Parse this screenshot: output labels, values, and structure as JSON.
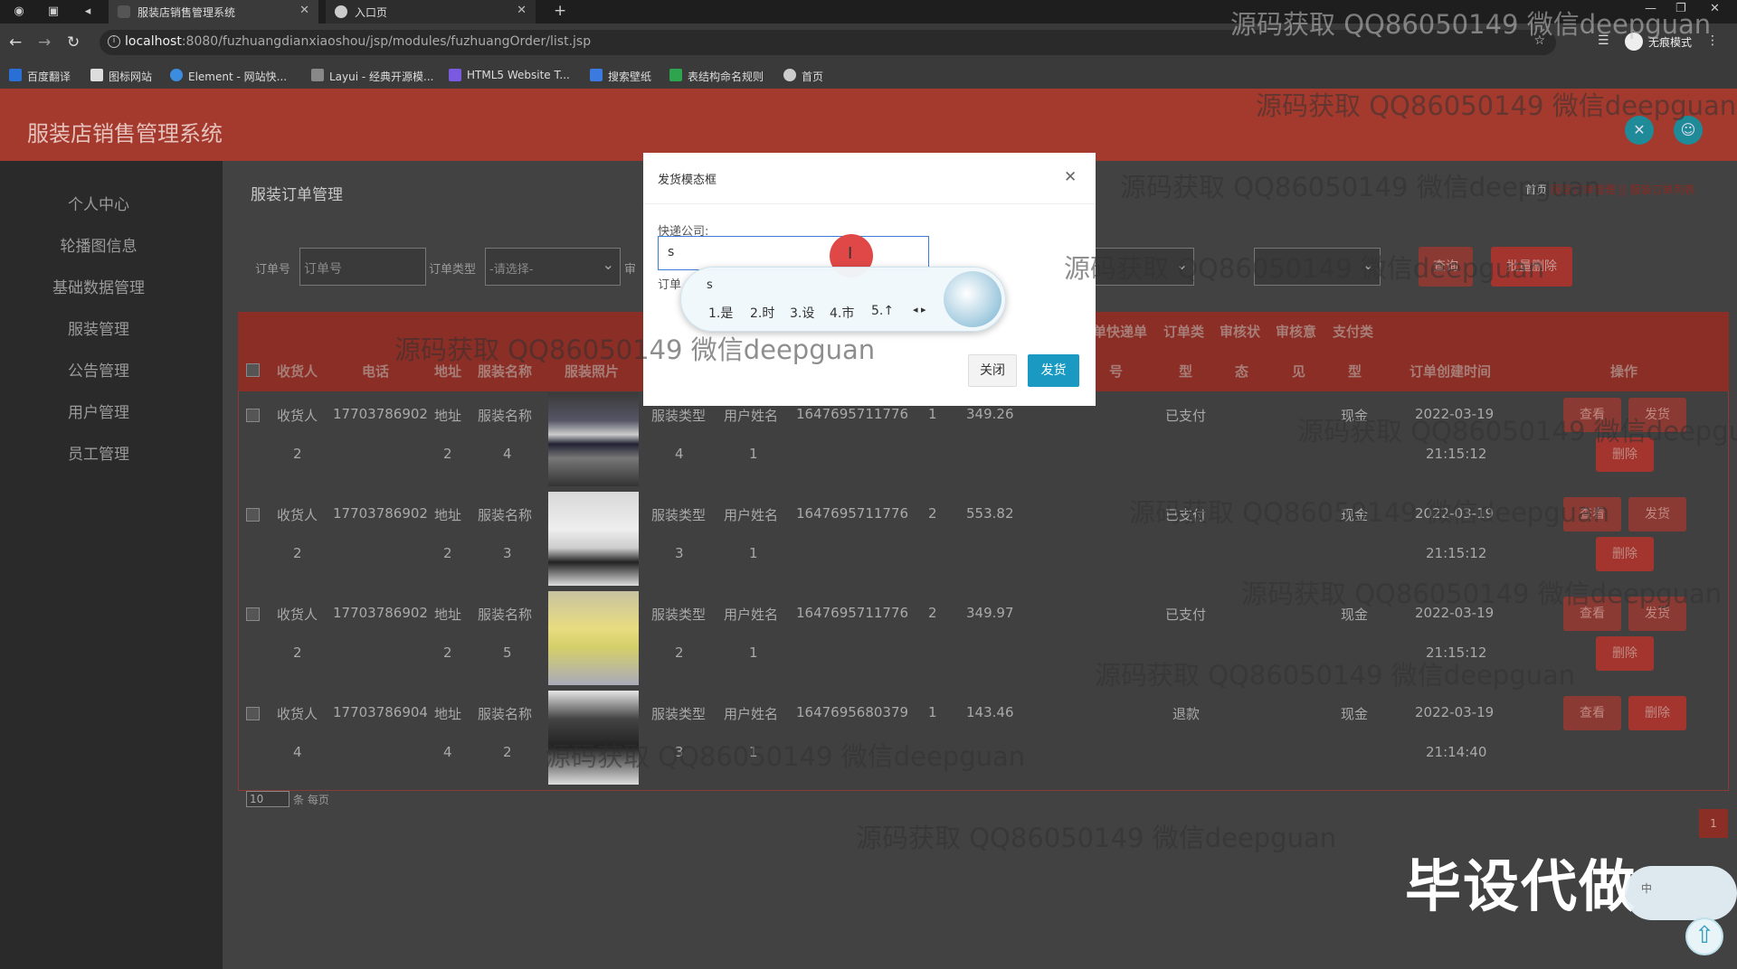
{
  "browser": {
    "tabs": [
      {
        "title": "服装店销售管理系统",
        "active": true
      },
      {
        "title": "入口页",
        "active": false
      }
    ],
    "url_host": "localhost",
    "url_path": ":8080/fuzhuangdianxiaoshou/jsp/modules/fuzhuangOrder/list.jsp",
    "incognito_label": "无痕模式",
    "bookmarks": [
      "百度翻译",
      "图标网站",
      "Element - 网站快...",
      "Layui - 经典开源模...",
      "HTML5 Website T...",
      "搜索壁纸",
      "表结构命名规则",
      "首页"
    ]
  },
  "app": {
    "title": "服装店销售管理系统"
  },
  "sidebar": {
    "items": [
      "个人中心",
      "轮播图信息",
      "基础数据管理",
      "服装管理",
      "公告管理",
      "用户管理",
      "员工管理"
    ]
  },
  "page": {
    "title": "服装订单管理",
    "breadcrumb": {
      "home": "首页",
      "section": "服装订单管理",
      "sep": "||",
      "current": "服装订单列表"
    }
  },
  "filters": {
    "order_no_label": "订单号",
    "order_no_placeholder": "订单号",
    "order_type_label": "订单类型",
    "order_type_value": "-请选择-",
    "review_label": "审",
    "search_btn": "查询",
    "batch_delete_btn": "批量删除"
  },
  "table": {
    "header_row_top": [
      "单快递单",
      "订单类",
      "审核状",
      "审核意",
      "支付类"
    ],
    "headers": [
      "收货人",
      "电话",
      "地址",
      "服装名称",
      "服装照片",
      "号",
      "型",
      "态",
      "见",
      "型",
      "订单创建时间",
      "操作"
    ],
    "rows": [
      {
        "receiver": "收货人",
        "receiver2": "2",
        "phone": "17703786902",
        "addr": "地址",
        "addr2": "2",
        "name": "服装名称",
        "name2": "4",
        "type": "服装类型",
        "type2": "4",
        "user": "用户姓名",
        "user2": "1",
        "order_no": "1647695711776",
        "qty": "1",
        "price": "349.26",
        "status": "已支付",
        "pay": "现金",
        "date": "2022-03-19",
        "time": "21:15:12",
        "actions": [
          "查看",
          "发货",
          "删除"
        ]
      },
      {
        "receiver": "收货人",
        "receiver2": "2",
        "phone": "17703786902",
        "addr": "地址",
        "addr2": "2",
        "name": "服装名称",
        "name2": "3",
        "type": "服装类型",
        "type2": "3",
        "user": "用户姓名",
        "user2": "1",
        "order_no": "1647695711776",
        "qty": "2",
        "price": "553.82",
        "status": "已支付",
        "pay": "现金",
        "date": "2022-03-19",
        "time": "21:15:12",
        "actions": [
          "查看",
          "发货",
          "删除"
        ]
      },
      {
        "receiver": "收货人",
        "receiver2": "2",
        "phone": "17703786902",
        "addr": "地址",
        "addr2": "2",
        "name": "服装名称",
        "name2": "5",
        "type": "服装类型",
        "type2": "2",
        "user": "用户姓名",
        "user2": "1",
        "order_no": "1647695711776",
        "qty": "2",
        "price": "349.97",
        "status": "已支付",
        "pay": "现金",
        "date": "2022-03-19",
        "time": "21:15:12",
        "actions": [
          "查看",
          "发货",
          "删除"
        ]
      },
      {
        "receiver": "收货人",
        "receiver2": "4",
        "phone": "17703786904",
        "addr": "地址",
        "addr2": "4",
        "name": "服装名称",
        "name2": "2",
        "type": "服装类型",
        "type2": "3",
        "user": "用户姓名",
        "user2": "1",
        "order_no": "1647695680379",
        "qty": "1",
        "price": "143.46",
        "status": "退款",
        "pay": "现金",
        "date": "2022-03-19",
        "time": "21:14:40",
        "actions": [
          "查看",
          "删除"
        ]
      }
    ],
    "page_size": "10",
    "page_size_label": "条 每页",
    "current_page": "1"
  },
  "modal": {
    "title": "发货模态框",
    "courier_label": "快递公司:",
    "courier_value": "s",
    "order_label": "订单",
    "close_btn": "关闭",
    "ship_btn": "发货"
  },
  "ime": {
    "composition": "s",
    "candidates": [
      "1.是",
      "2.时",
      "3.设",
      "4.市",
      "5.↑"
    ]
  },
  "watermark": "源码获取 QQ86050149 微信deepguan",
  "promo": "毕设代做",
  "widget_text": "中"
}
